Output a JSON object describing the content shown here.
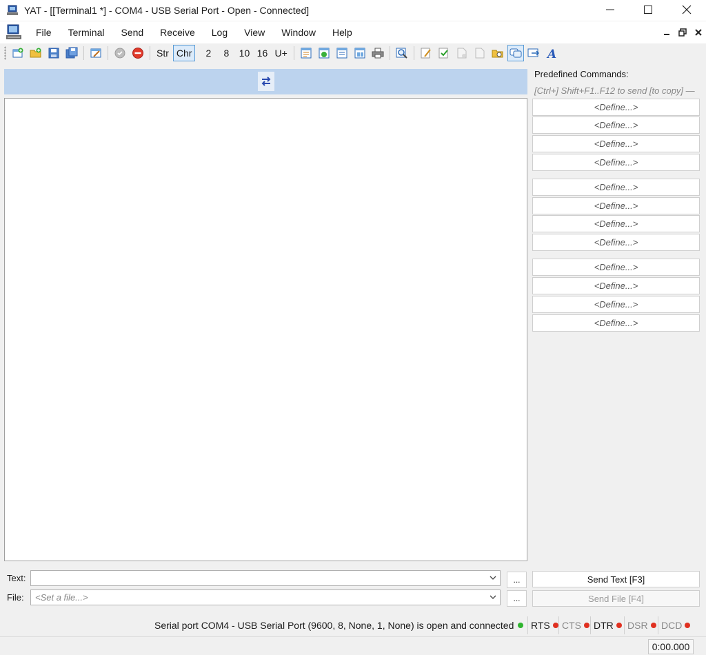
{
  "window": {
    "title": "YAT - [[Terminal1 *] - COM4 - USB Serial Port - Open - Connected]"
  },
  "menu": {
    "items": [
      "File",
      "Terminal",
      "Send",
      "Receive",
      "Log",
      "View",
      "Window",
      "Help"
    ]
  },
  "toolbar": {
    "radix_str": "Str",
    "radix_chr": "Chr",
    "radix_2": "2",
    "radix_8": "8",
    "radix_10": "10",
    "radix_16": "16",
    "radix_unicode": "U+"
  },
  "predefined": {
    "title": "Predefined Commands:",
    "hint": "[Ctrl+] Shift+F1..F12 to send [to copy]",
    "buttons": [
      "<Define...>",
      "<Define...>",
      "<Define...>",
      "<Define...>",
      "<Define...>",
      "<Define...>",
      "<Define...>",
      "<Define...>",
      "<Define...>",
      "<Define...>",
      "<Define...>",
      "<Define...>"
    ]
  },
  "send": {
    "text_label": "Text:",
    "text_value": "",
    "file_label": "File:",
    "file_placeholder": "<Set a file...>",
    "dots": "...",
    "send_text_button": "Send Text [F3]",
    "send_file_button": "Send File [F4]"
  },
  "status": {
    "message": "Serial port COM4 - USB Serial Port (9600, 8, None, 1, None) is open and connected",
    "signals": {
      "rts": "RTS",
      "cts": "CTS",
      "dtr": "DTR",
      "dsr": "DSR",
      "dcd": "DCD"
    },
    "timer": "0:00.000"
  },
  "colors": {
    "led_on": "#2fb42f",
    "led_off": "#e03020",
    "monitor_header": "#bcd3ee"
  },
  "icons": {
    "toolbar": [
      "new-terminal-icon",
      "open-terminal-icon",
      "save-terminal-icon",
      "save-workspace-icon",
      "terminal-settings-icon",
      "open-connection-icon",
      "close-connection-icon",
      "radix-str",
      "radix-chr",
      "radix-2",
      "radix-8",
      "radix-10",
      "radix-16",
      "radix-unicode",
      "show-tx-icon",
      "show-bidir-icon",
      "show-rx-icon",
      "clear-icon",
      "print-icon",
      "find-icon",
      "log-settings-icon",
      "log-on-icon",
      "log-off-icon",
      "log-clear-icon",
      "log-open-icon",
      "predefined-panel-icon",
      "send-panel-icon",
      "format-icon"
    ]
  }
}
